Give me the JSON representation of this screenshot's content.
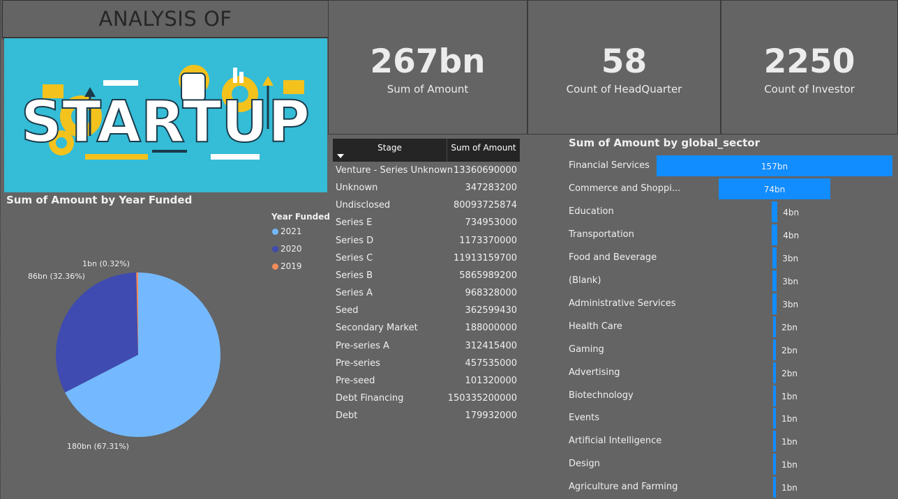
{
  "header": {
    "title": "ANALYSIS OF"
  },
  "banner": {
    "word": "STARTUP"
  },
  "kpis": [
    {
      "value": "267bn",
      "label": "Sum of Amount"
    },
    {
      "value": "58",
      "label": "Count of HeadQuarter"
    },
    {
      "value": "2250",
      "label": "Count of Investor"
    }
  ],
  "colors": {
    "background": "#646464",
    "bar": "#118dff",
    "pie_2021": "#74b9ff",
    "pie_2020": "#3f4bb0",
    "pie_2019": "#f28b5b",
    "table_header": "#252525"
  },
  "pie_chart": {
    "title": "Sum of Amount by Year Funded",
    "legend_title": "Year Funded",
    "slice_labels": [
      "180bn (67.31%)",
      "86bn (32.36%)",
      "1bn (0.32%)"
    ]
  },
  "table": {
    "headers": [
      "Stage",
      "Sum of Amount"
    ],
    "rows": [
      [
        "Venture - Series Unknown",
        "13360690000"
      ],
      [
        "Unknown",
        "347283200"
      ],
      [
        "Undisclosed",
        "80093725874"
      ],
      [
        "Series E",
        "734953000"
      ],
      [
        "Series D",
        "1173370000"
      ],
      [
        "Series C",
        "11913159700"
      ],
      [
        "Series B",
        "5865989200"
      ],
      [
        "Series A",
        "968328000"
      ],
      [
        "Seed",
        "362599430"
      ],
      [
        "Secondary Market",
        "188000000"
      ],
      [
        "Pre-series A",
        "312415400"
      ],
      [
        "Pre-series",
        "457535000"
      ],
      [
        "Pre-seed",
        "101320000"
      ],
      [
        "Debt Financing",
        "150335200000"
      ],
      [
        "Debt",
        "179932000"
      ]
    ]
  },
  "bar_chart": {
    "title": "Sum of Amount by global_sector",
    "display_labels": [
      "Financial Services",
      "Commerce and Shoppi...",
      "Education",
      "Transportation",
      "Food and Beverage",
      "(Blank)",
      "Administrative Services",
      "Health Care",
      "Gaming",
      "Advertising",
      "Biotechnology",
      "Events",
      "Artificial Intelligence",
      "Design",
      "Agriculture and Farming"
    ],
    "value_labels": [
      "157bn",
      "74bn",
      "4bn",
      "4bn",
      "3bn",
      "3bn",
      "3bn",
      "2bn",
      "2bn",
      "2bn",
      "1bn",
      "1bn",
      "1bn",
      "1bn",
      "1bn"
    ]
  },
  "chart_data": [
    {
      "type": "pie",
      "title": "Sum of Amount by Year Funded",
      "legend_title": "Year Funded",
      "legend_position": "top-right",
      "labels": [
        "2021",
        "2020",
        "2019"
      ],
      "values": [
        180,
        86,
        1
      ],
      "percentages": [
        67.31,
        32.36,
        0.32
      ],
      "unit": "bn"
    },
    {
      "type": "bar",
      "orientation": "horizontal",
      "title": "Sum of Amount by global_sector",
      "categories": [
        "Financial Services",
        "Commerce and Shopping",
        "Education",
        "Transportation",
        "Food and Beverage",
        "(Blank)",
        "Administrative Services",
        "Health Care",
        "Gaming",
        "Advertising",
        "Biotechnology",
        "Events",
        "Artificial Intelligence",
        "Design",
        "Agriculture and Farming"
      ],
      "values": [
        157,
        74,
        4,
        4,
        3,
        3,
        3,
        2,
        2,
        2,
        1,
        1,
        1,
        1,
        1
      ],
      "unit": "bn"
    },
    {
      "type": "table",
      "columns": [
        "Stage",
        "Sum of Amount"
      ],
      "rows": [
        [
          "Venture - Series Unknown",
          13360690000
        ],
        [
          "Unknown",
          347283200
        ],
        [
          "Undisclosed",
          80093725874
        ],
        [
          "Series E",
          734953000
        ],
        [
          "Series D",
          1173370000
        ],
        [
          "Series C",
          11913159700
        ],
        [
          "Series B",
          5865989200
        ],
        [
          "Series A",
          968328000
        ],
        [
          "Seed",
          362599430
        ],
        [
          "Secondary Market",
          188000000
        ],
        [
          "Pre-series A",
          312415400
        ],
        [
          "Pre-series",
          457535000
        ],
        [
          "Pre-seed",
          101320000
        ],
        [
          "Debt Financing",
          150335200000
        ],
        [
          "Debt",
          179932000
        ]
      ]
    }
  ]
}
